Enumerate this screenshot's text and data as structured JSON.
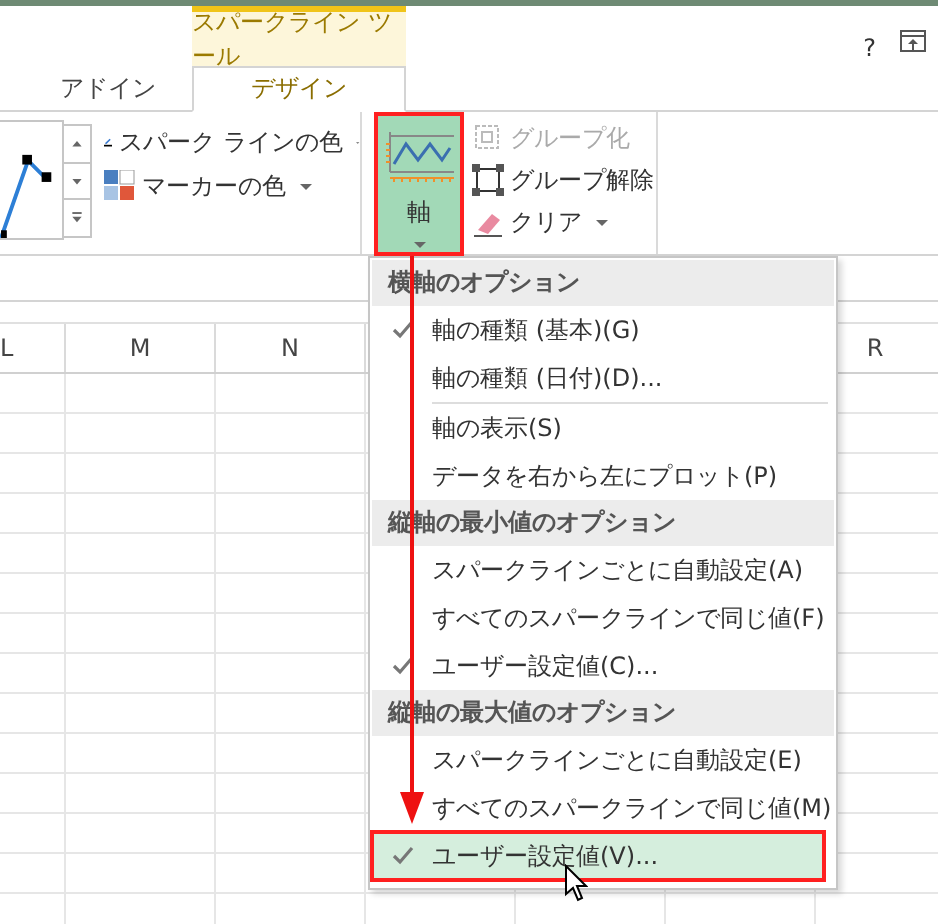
{
  "ribbon": {
    "context_group": "スパークライン ツール",
    "tabs": [
      {
        "label": "アドイン",
        "selected": false
      },
      {
        "label": "デザイン",
        "selected": true
      }
    ],
    "help": "?",
    "style_commands": [
      {
        "kind": "line-color",
        "label": "スパーク ラインの色"
      },
      {
        "kind": "marker-color",
        "label": "マーカーの色"
      }
    ],
    "axis_button": {
      "label": "軸",
      "pressed": true
    },
    "group_commands": [
      {
        "kind": "group",
        "label": "グループ化",
        "disabled": true
      },
      {
        "kind": "ungroup",
        "label": "グループ解除",
        "disabled": false
      },
      {
        "kind": "clear",
        "label": "クリア",
        "disabled": false
      }
    ]
  },
  "sheet": {
    "columns": [
      "L",
      "M",
      "N"
    ],
    "right_columns": [
      "R"
    ]
  },
  "axis_menu": {
    "items": [
      {
        "kind": "header",
        "label": "横軸のオプション"
      },
      {
        "kind": "option",
        "label": "軸の種類 (基本)(G)",
        "checked": true,
        "selected": false
      },
      {
        "kind": "option",
        "label": "軸の種類 (日付)(D)...",
        "checked": false,
        "selected": false
      },
      {
        "kind": "separator"
      },
      {
        "kind": "option",
        "label": "軸の表示(S)",
        "checked": false,
        "selected": false
      },
      {
        "kind": "option",
        "label": "データを右から左にプロット(P)",
        "checked": false,
        "selected": false
      },
      {
        "kind": "header",
        "label": "縦軸の最小値のオプション"
      },
      {
        "kind": "option",
        "label": "スパークラインごとに自動設定(A)",
        "checked": false,
        "selected": false
      },
      {
        "kind": "option",
        "label": "すべてのスパークラインで同じ値(F)",
        "checked": false,
        "selected": false
      },
      {
        "kind": "option",
        "label": "ユーザー設定値(C)...",
        "checked": true,
        "selected": false
      },
      {
        "kind": "header",
        "label": "縦軸の最大値のオプション"
      },
      {
        "kind": "option",
        "label": "スパークラインごとに自動設定(E)",
        "checked": false,
        "selected": false
      },
      {
        "kind": "option",
        "label": "すべてのスパークラインで同じ値(M)",
        "checked": false,
        "selected": false
      },
      {
        "kind": "option",
        "label": "ユーザー設定値(V)...",
        "checked": true,
        "selected": true
      }
    ]
  }
}
